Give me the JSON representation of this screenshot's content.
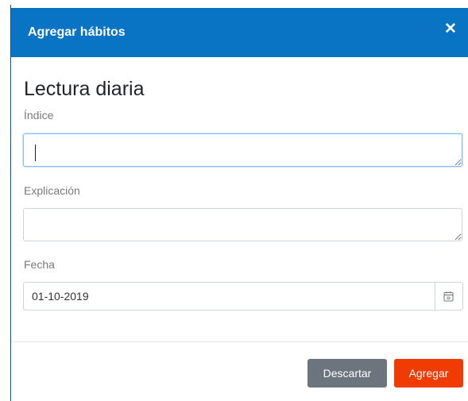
{
  "header": {
    "title": "Agregar hábitos",
    "close_label": "✕"
  },
  "habit": {
    "name": "Lectura diaria"
  },
  "fields": {
    "indice": {
      "label": "Índice",
      "value": ""
    },
    "explicacion": {
      "label": "Explicación",
      "value": ""
    },
    "fecha": {
      "label": "Fecha",
      "value": "01-10-2019"
    }
  },
  "footer": {
    "discard_label": "Descartar",
    "add_label": "Agregar"
  },
  "colors": {
    "header_bg": "#0a74c4",
    "discard_bg": "#6c757d",
    "add_bg": "#f03c02"
  },
  "icons": {
    "close": "close-icon",
    "calendar": "calendar-icon"
  }
}
